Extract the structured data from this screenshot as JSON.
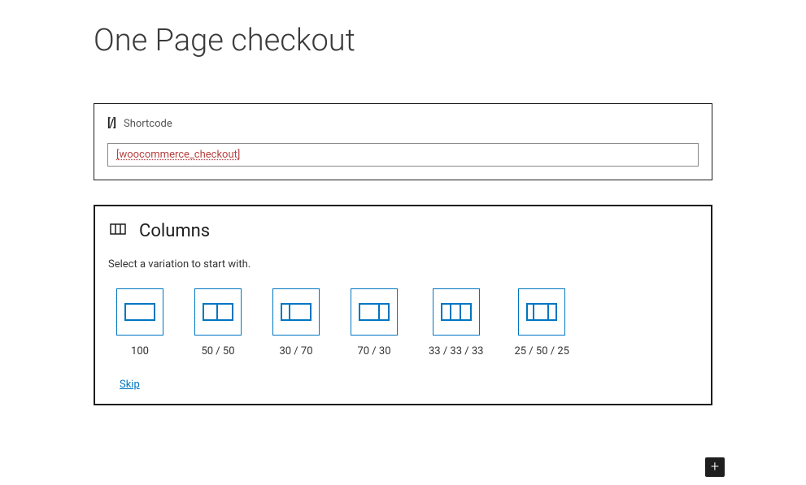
{
  "page": {
    "title": "One Page checkout"
  },
  "shortcode_block": {
    "icon": "[/]",
    "label": "Shortcode",
    "value": "[woocommerce_checkout]"
  },
  "columns_block": {
    "title": "Columns",
    "subtitle": "Select a variation to start with.",
    "variations": [
      {
        "label": "100",
        "cols": [
          34
        ]
      },
      {
        "label": "50 / 50",
        "cols": [
          17,
          17
        ]
      },
      {
        "label": "30 / 70",
        "cols": [
          10,
          24
        ]
      },
      {
        "label": "70 / 30",
        "cols": [
          24,
          10
        ]
      },
      {
        "label": "33 / 33 / 33",
        "cols": [
          11,
          12,
          11
        ]
      },
      {
        "label": "25 / 50 / 25",
        "cols": [
          8,
          18,
          8
        ]
      }
    ],
    "skip": "Skip"
  },
  "add_button": {
    "glyph": "+"
  }
}
